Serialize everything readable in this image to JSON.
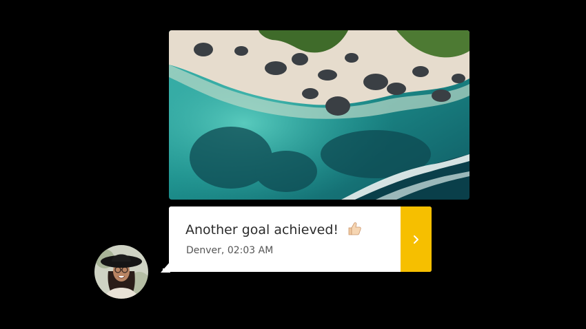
{
  "message": {
    "title": "Another goal achieved!",
    "emoji": "thumbs-up-icon",
    "location_time": "Denver, 02:03 AM"
  },
  "colors": {
    "background": "#000000",
    "card": "#ffffff",
    "accent": "#f6bf00",
    "title_text": "#2b2b2b",
    "subtitle_text": "#555555"
  },
  "icons": {
    "action": "chevron-right-icon",
    "avatar": "user-avatar"
  }
}
